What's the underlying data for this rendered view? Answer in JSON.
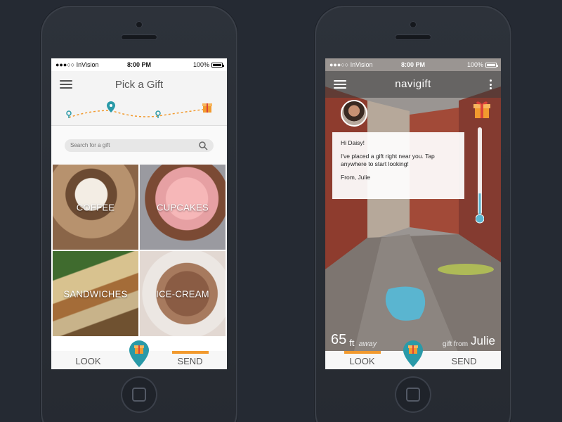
{
  "left_phone": {
    "status": {
      "carrier": "●●●○○ InVision",
      "time": "8:00 PM",
      "battery": "100%"
    },
    "title": "Pick a Gift",
    "search": {
      "placeholder": "Search for a gift"
    },
    "tiles": [
      "COFFEE",
      "CUPCAKES",
      "SANDWICHES",
      "ICE-CREAM"
    ],
    "nav": {
      "look": "LOOK",
      "send": "SEND"
    }
  },
  "right_phone": {
    "status": {
      "carrier": "●●●○○ InVision",
      "time": "8:00 PM",
      "battery": "100%"
    },
    "title": "navigift",
    "message": {
      "greeting": "Hi Daisy!",
      "body": "I've placed a gift right near you. Tap anywhere to start looking!",
      "signoff": "From, Julie"
    },
    "distance": {
      "value": "65",
      "unit": "ft",
      "away": "away"
    },
    "gift_from": {
      "label": "gift from",
      "name": "Julie"
    },
    "nav": {
      "look": "LOOK",
      "send": "SEND"
    }
  },
  "colors": {
    "accent_teal": "#2a9aa8",
    "accent_orange": "#f29a2e",
    "background": "#252a33"
  },
  "icons": [
    "hamburger-icon",
    "map-pin-icon",
    "gift-icon",
    "search-icon",
    "kebab-icon",
    "wifi-icon",
    "battery-icon",
    "thermometer-icon"
  ]
}
